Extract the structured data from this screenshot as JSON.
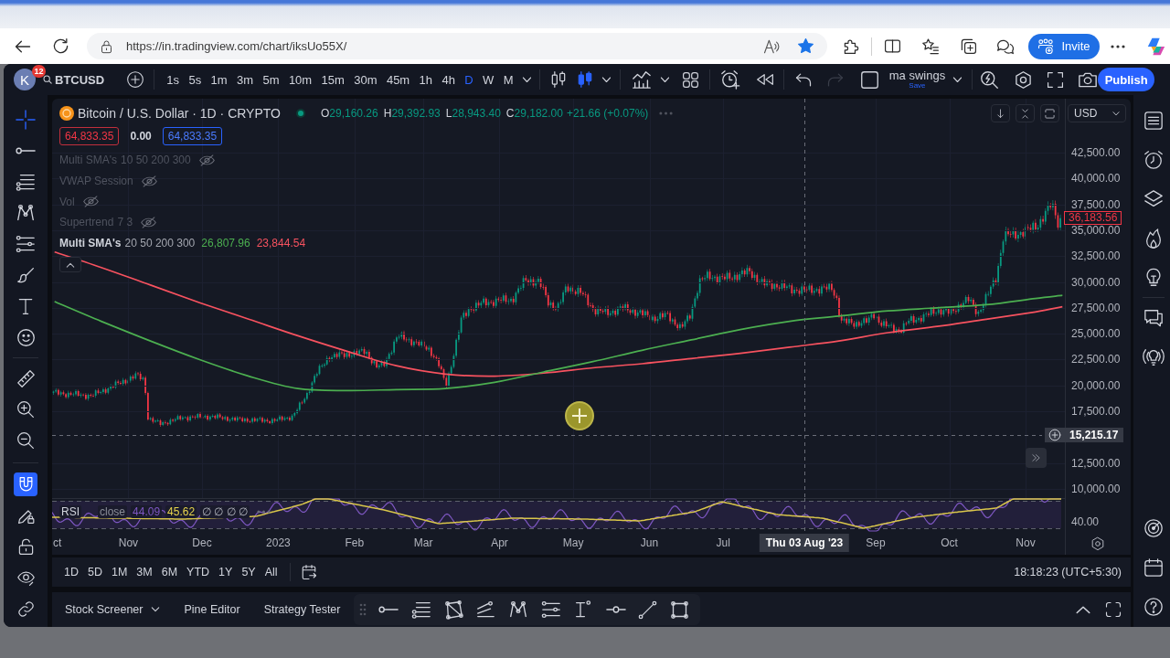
{
  "browser": {
    "url": "https://in.tradingview.com/chart/iksUo55X/",
    "bookmarked": true,
    "invite_button": "Invite"
  },
  "toolbar": {
    "avatar_initial": "K",
    "notification_count": "12",
    "symbol": "BTCUSD",
    "intervals": [
      {
        "label": "1s",
        "selected": false
      },
      {
        "label": "5s",
        "selected": false
      },
      {
        "label": "1m",
        "selected": false
      },
      {
        "label": "3m",
        "selected": false
      },
      {
        "label": "5m",
        "selected": false
      },
      {
        "label": "10m",
        "selected": false
      },
      {
        "label": "15m",
        "selected": false
      },
      {
        "label": "30m",
        "selected": false
      },
      {
        "label": "45m",
        "selected": false
      },
      {
        "label": "1h",
        "selected": false
      },
      {
        "label": "4h",
        "selected": false
      },
      {
        "label": "D",
        "selected": true
      },
      {
        "label": "W",
        "selected": false
      },
      {
        "label": "M",
        "selected": false
      }
    ],
    "chart_styles": [
      {
        "kind": "hollow-candles",
        "selected": false
      },
      {
        "kind": "candles",
        "selected": true
      }
    ],
    "history": [
      {
        "kind": "undo",
        "disabled": false
      },
      {
        "kind": "redo",
        "disabled": true
      }
    ],
    "layout_name": "ma swings",
    "layout_status": "Save",
    "publish_button": "Publish"
  },
  "left_toolbar": {
    "tools": [
      {
        "kind": "crosshair",
        "selected": true
      },
      {
        "kind": "trend-line",
        "selected": false
      },
      {
        "kind": "fib-retracement",
        "selected": false
      },
      {
        "kind": "pattern",
        "selected": false
      },
      {
        "kind": "forecast",
        "selected": false
      },
      {
        "kind": "brush",
        "selected": false
      },
      {
        "kind": "text",
        "selected": false
      },
      {
        "kind": "emoji",
        "selected": false
      },
      {
        "kind": "measure",
        "selected": false
      },
      {
        "kind": "zoom-in",
        "selected": false
      },
      {
        "kind": "zoom-out",
        "selected": false
      }
    ],
    "toggles": [
      {
        "kind": "magnet",
        "on": true
      },
      {
        "kind": "lock-drawings",
        "on": false
      },
      {
        "kind": "lock-all",
        "on": false
      },
      {
        "kind": "hide-drawings",
        "on": false
      },
      {
        "kind": "sync-drawings",
        "on": false
      }
    ]
  },
  "chart": {
    "legend": {
      "title": "Bitcoin / U.S. Dollar · 1D · CRYPTO",
      "market_open": true,
      "ohlc": [
        {
          "label": "O",
          "value": "29,160.26"
        },
        {
          "label": "H",
          "value": "29,392.93"
        },
        {
          "label": "L",
          "value": "28,943.40"
        },
        {
          "label": "C",
          "value": "29,182.00"
        }
      ],
      "change": "+21.66 (+0.07%)",
      "trade_buttons": [
        {
          "kind": "sell",
          "price": "64,833.35"
        },
        {
          "kind": "spread",
          "price": "0.00"
        },
        {
          "kind": "buy",
          "price": "64,833.35"
        }
      ],
      "indicators": [
        {
          "name": "Multi SMA's",
          "params": "10 50 200 300",
          "hidden": true
        },
        {
          "name": "VWAP Session",
          "hidden": true
        },
        {
          "name": "Vol",
          "hidden": true
        },
        {
          "name": "Supertrend",
          "params": "7 3",
          "hidden": true
        },
        {
          "name": "Multi SMA's",
          "params": "20 50 200 300",
          "hidden": false,
          "values": [
            {
              "text": "26,807.96",
              "color": "#4caf50"
            },
            {
              "text": "23,844.54",
              "color": "#f7525f"
            }
          ]
        }
      ]
    },
    "currency": "USD",
    "chart_data": {
      "type": "line",
      "grid": true,
      "x": [
        "2022-10-02",
        "2022-10-21",
        "2022-11-10",
        "2022-11-30",
        "2022-12-20",
        "2023-01-09",
        "2023-01-29",
        "2023-02-18",
        "2023-03-10",
        "2023-03-30",
        "2023-04-19",
        "2023-05-09",
        "2023-05-29",
        "2023-06-18",
        "2023-07-08",
        "2023-07-28",
        "2023-08-17",
        "2023-09-06",
        "2023-09-26",
        "2023-10-16",
        "2023-11-05",
        "2023-11-16"
      ],
      "series": [
        {
          "color": "#f7525f",
          "values": [
            32900,
            31400,
            29700,
            28000,
            26400,
            24800,
            23300,
            21900,
            21100,
            20900,
            21200,
            21700,
            22100,
            22600,
            23100,
            23700,
            24300,
            25100,
            25700,
            26400,
            27100,
            27600
          ]
        },
        {
          "color": "#4caf50",
          "values": [
            28100,
            26200,
            24300,
            22500,
            20900,
            19700,
            19500,
            19600,
            19700,
            20300,
            21300,
            22300,
            23400,
            24400,
            25400,
            26200,
            26700,
            27200,
            27500,
            27800,
            28400,
            28700
          ]
        }
      ],
      "ref_lines": [
        {
          "axis": "x",
          "value": "2023-08-03"
        },
        {
          "axis": "y",
          "value": 15215
        }
      ],
      "xlim": [
        "2022-10-01",
        "2023-11-17"
      ],
      "ylim": [
        9117,
        47708
      ],
      "xticks": [
        {
          "value": "2022-10-01",
          "label": "ct"
        },
        {
          "value": "2022-11-01",
          "label": "Nov"
        },
        {
          "value": "2022-12-01",
          "label": "Dec"
        },
        {
          "value": "2023-01-01",
          "label": "2023"
        },
        {
          "value": "2023-02-01",
          "label": "Feb"
        },
        {
          "value": "2023-03-01",
          "label": "Mar"
        },
        {
          "value": "2023-04-01",
          "label": "Apr"
        },
        {
          "value": "2023-05-01",
          "label": "May"
        },
        {
          "value": "2023-06-01",
          "label": "Jun"
        },
        {
          "value": "2023-07-01",
          "label": "Jul"
        },
        {
          "value": "2023-09-01",
          "label": "Sep"
        },
        {
          "value": "2023-10-01",
          "label": "Oct"
        },
        {
          "value": "2023-11-01",
          "label": "Nov"
        }
      ],
      "yticks": [
        {
          "value": 42500,
          "label": "42,500.00"
        },
        {
          "value": 40000,
          "label": "40,000.00"
        },
        {
          "value": 37500,
          "label": "37,500.00"
        },
        {
          "value": 35000,
          "label": "35,000.00"
        },
        {
          "value": 32500,
          "label": "32,500.00"
        },
        {
          "value": 30000,
          "label": "30,000.00"
        },
        {
          "value": 27500,
          "label": "27,500.00"
        },
        {
          "value": 25000,
          "label": "25,000.00"
        },
        {
          "value": 22500,
          "label": "22,500.00"
        },
        {
          "value": 20000,
          "label": "20,000.00"
        },
        {
          "value": 17500,
          "label": "17,500.00"
        },
        {
          "value": 12500,
          "label": "12,500.00"
        },
        {
          "value": 10000,
          "label": "10,000.00"
        }
      ]
    },
    "last_price": "36,183.56",
    "crosshair_price": "15,215.17",
    "rsi": {
      "name": "RSI",
      "source": "close",
      "values": [
        {
          "text": "44.09",
          "color": "#7e57c2"
        },
        {
          "text": "45.62",
          "color": "#e8d44d"
        }
      ],
      "na_values": "∅ ∅ ∅ ∅",
      "axis_label": "40.00"
    },
    "crosshair_date": "Thu 03 Aug '23"
  },
  "range_bar": {
    "ranges": [
      "1D",
      "5D",
      "1M",
      "3M",
      "6M",
      "YTD",
      "1Y",
      "5Y",
      "All"
    ],
    "clock": "18:18:23 (UTC+5:30)"
  },
  "bottom_panel": {
    "tabs": [
      {
        "label": "Stock Screener",
        "kind": "dropdown"
      },
      {
        "label": "Pine Editor",
        "kind": "plain"
      },
      {
        "label": "Strategy Tester",
        "kind": "plain"
      }
    ]
  }
}
